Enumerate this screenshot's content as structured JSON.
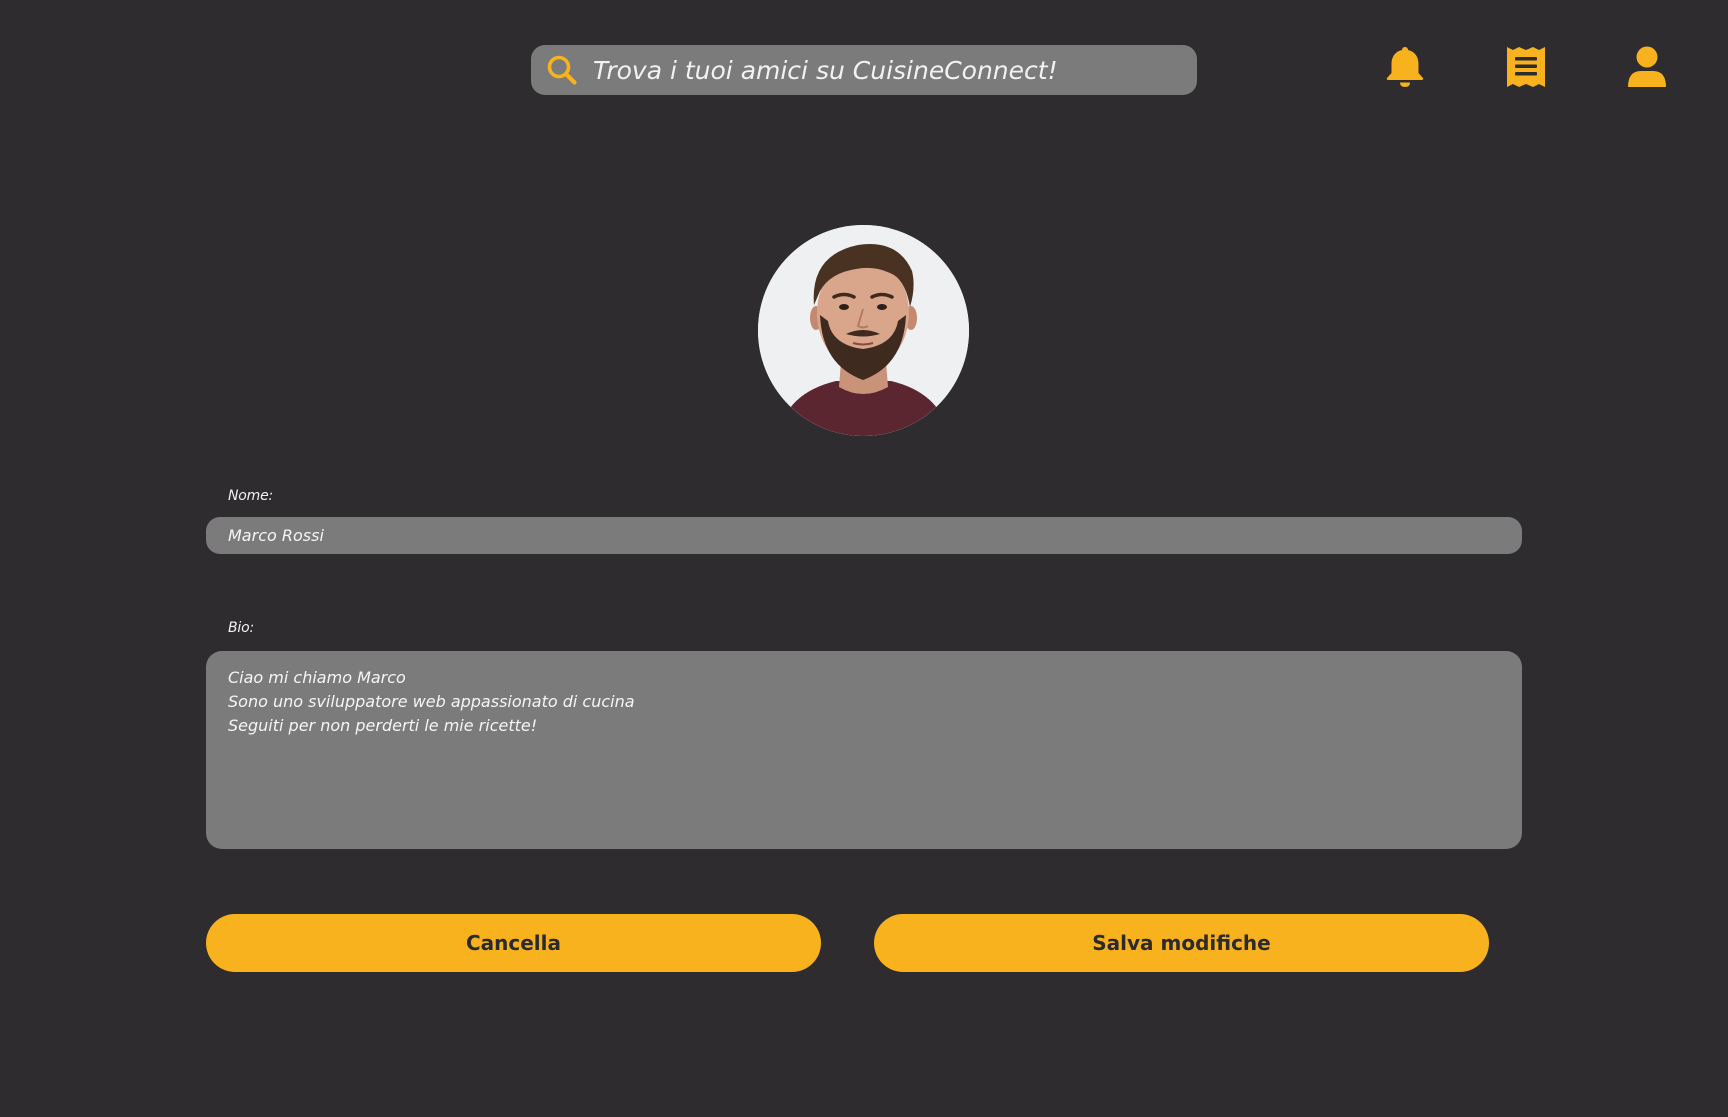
{
  "header": {
    "search_placeholder": "Trova i tuoi amici su CuisineConnect!",
    "icons": [
      "search-icon",
      "bell-icon",
      "receipt-icon",
      "user-icon"
    ]
  },
  "profile": {
    "name_label": "Nome:",
    "name_value": "Marco Rossi",
    "bio_label": "Bio:",
    "bio_value": "Ciao mi chiamo Marco\nSono uno sviluppatore web appassionato di cucina\nSeguiti per non perderti le mie ricette!"
  },
  "actions": {
    "cancel_label": "Cancella",
    "save_label": "Salva modifiche"
  },
  "colors": {
    "background": "#2e2c2f",
    "accent": "#f7b21e",
    "field": "#7b7b7b"
  }
}
